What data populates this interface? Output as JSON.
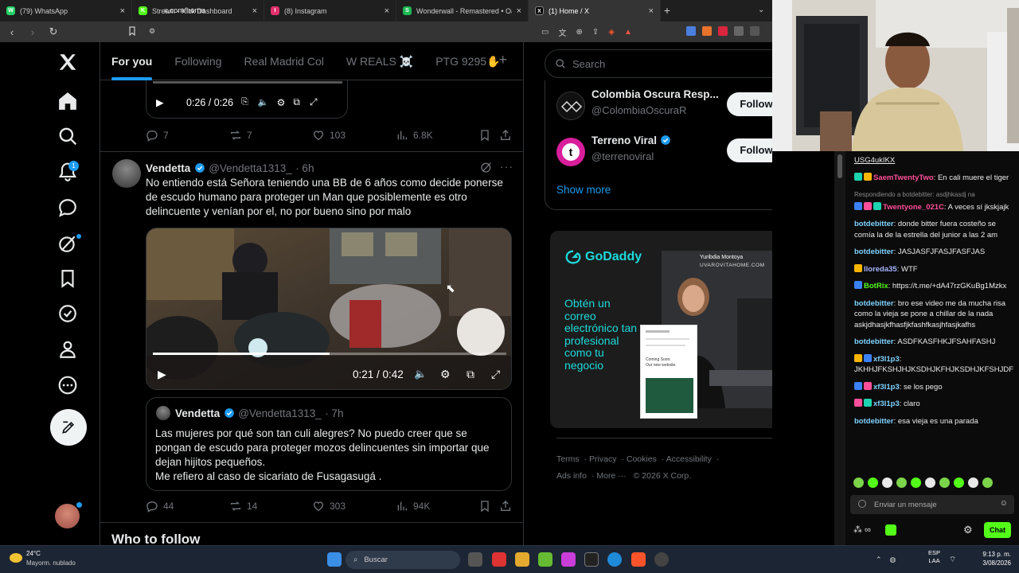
{
  "browser": {
    "tabs": [
      {
        "title": "(79) WhatsApp",
        "color": "#25d366",
        "glyph": "W"
      },
      {
        "title": "Stream - Kick Dashboard",
        "color": "#53fc18",
        "glyph": "K"
      },
      {
        "title": "(8) Instagram",
        "color": "#e1306c",
        "glyph": "I"
      },
      {
        "title": "Wonderwall - Remastered • Oasis",
        "color": "#1db954",
        "glyph": "S"
      },
      {
        "title": "(1) Home / X",
        "color": "#000000",
        "glyph": "X"
      }
    ],
    "url": "x.com/home"
  },
  "nav": {
    "notifications_count": "1"
  },
  "feed": {
    "tabs": [
      "For you",
      "Following",
      "Real Madrid Col",
      "W REALS ☠️",
      "PTG 9295✋"
    ],
    "top_video": {
      "time": "0:26 / 0:26"
    },
    "top_actions": {
      "replies": "7",
      "reposts": "7",
      "likes": "103",
      "views": "6.8K"
    },
    "tweet": {
      "name": "Vendetta",
      "handle": "@Vendetta1313_",
      "time": "· 6h",
      "text": "No entiendo está Señora teniendo una BB de 6 años como decide ponerse de escudo humano para proteger un Man que posiblemente es otro delincuente y venían por el, no por bueno sino por malo",
      "video_time": "0:21 / 0:42",
      "video_progress": 0.5,
      "quoted": {
        "name": "Vendetta",
        "handle": "@Vendetta1313_",
        "time": "· 7h",
        "text": "Las mujeres por qué son tan culi alegres? No puedo creer que se pongan de escudo para proteger mozos delincuentes sin importar que dejan hijitos pequeños.\nMe refiero al caso de sicariato de Fusagasugá ."
      },
      "actions": {
        "replies": "44",
        "reposts": "14",
        "likes": "303",
        "views": "94K"
      }
    },
    "who_to_follow": "Who to follow"
  },
  "right": {
    "search_placeholder": "Search",
    "follow_suggestions": [
      {
        "name": "Colombia Oscura Resp...",
        "handle": "@ColombiaOscuraR",
        "button": "Follow"
      },
      {
        "name": "Terreno Viral",
        "handle": "@terrenoviral",
        "button": "Follow"
      }
    ],
    "show_more": "Show more",
    "ad": {
      "brand": "GoDaddy",
      "headline": "Obtén un correo electrónico tan profesional como tu negocio",
      "person_name": "Yuribdia Montoya",
      "person_site": "UVAROVITAHOME.COM",
      "card_text1": "Coming Soon:",
      "card_text2": "Our new website."
    },
    "footer": [
      "Terms",
      "Privacy",
      "Cookies",
      "Accessibility",
      "Ads info",
      "More ···",
      "© 2026 X Corp."
    ]
  },
  "chat": {
    "messages": [
      {
        "user": "",
        "text": "USG4ukIKX",
        "color": "#ececec",
        "underline": true
      },
      {
        "user": "SaemTwentyTwo",
        "text": ": En cali muere el tiger",
        "color": "#ff4f9a"
      },
      {
        "user": "",
        "text": "Respondiendo a botdebitter: asdjhkasdj na",
        "color": "#888",
        "reply": true
      },
      {
        "user": "Twentyone_021C",
        "text": ": A veces sí jkskjajk",
        "color": "#ff4f9a"
      },
      {
        "user": "botdebitter",
        "text": ": donde bitter fuera costeño se comía la de la estrella del junior a las 2 am",
        "color": "#7fd3ff"
      },
      {
        "user": "botdebitter",
        "text": ": JASJASFJFASJFASFJAS",
        "color": "#7fd3ff"
      },
      {
        "user": "lloreda35",
        "text": ": WTF",
        "color": "#a7b4ff"
      },
      {
        "user": "BotRix",
        "text": ": https://t.me/+dA47rzGKuBg1Mzkx",
        "color": "#53fc18"
      },
      {
        "user": "botdebitter",
        "text": ": bro ese video me da mucha risa como la vieja se pone a chillar de la nada askjdhasjkfhasfjkfashfkasjhfasjkafhs",
        "color": "#7fd3ff"
      },
      {
        "user": "botdebitter",
        "text": ": ASDFKASFHKJFSAHFASHJ",
        "color": "#7fd3ff"
      },
      {
        "user": "xf3l1p3",
        "text": ": JKHHJFKSHJHJKSDHJKFHJKSDHJKFSHJDF",
        "color": "#7fd3ff"
      },
      {
        "user": "xf3l1p3",
        "text": ": se los pego",
        "color": "#7fd3ff"
      },
      {
        "user": "xf3l1p3",
        "text": ": claro",
        "color": "#7fd3ff"
      },
      {
        "user": "botdebitter",
        "text": ": esa vieja es una parada",
        "color": "#7fd3ff"
      }
    ],
    "input_placeholder": "Enviar un mensaje",
    "send_label": "Chat"
  },
  "taskbar": {
    "weather_temp": "24°C",
    "weather_desc": "Mayorm. nublado",
    "search_placeholder": "Buscar",
    "lang1": "ESP",
    "lang2": "LAA",
    "time": "9:13 p. m.",
    "date": "3/08/2026"
  }
}
